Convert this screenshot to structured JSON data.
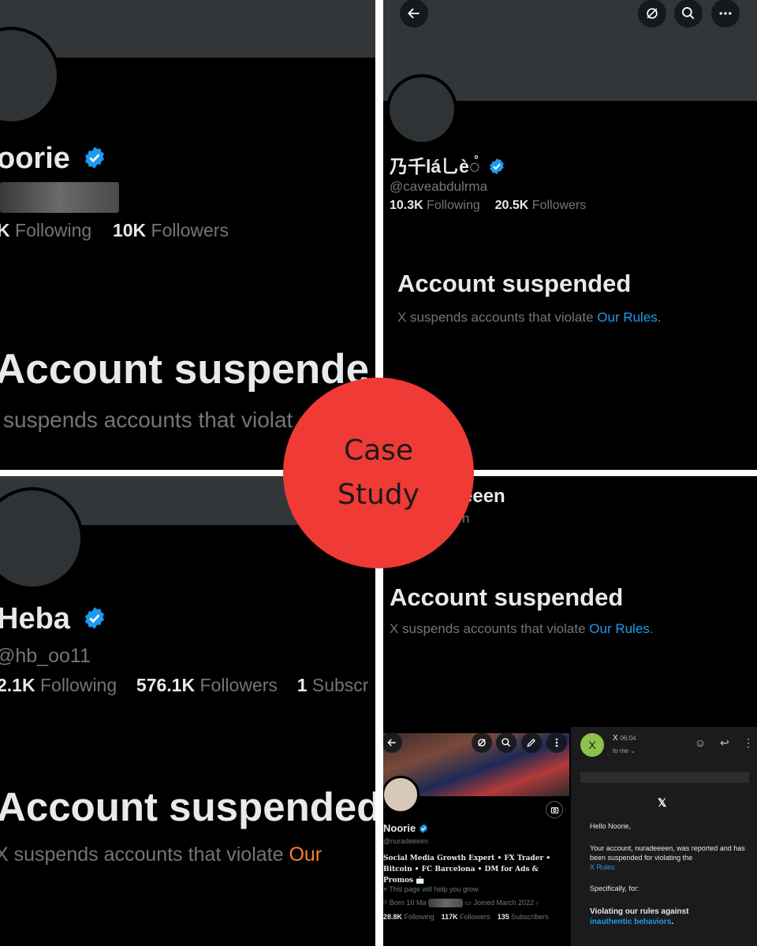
{
  "panel1": {
    "name": "oorie",
    "following_value": "K",
    "following_label": "Following",
    "followers_value": "10K",
    "followers_label": "Followers",
    "suspended_title": "Account suspende",
    "suspended_text": "suspends accounts that violat"
  },
  "panel2": {
    "name": "乃千lá乚è◌̊",
    "handle": "@caveabdulrma",
    "following_value": "10.3K",
    "following_label": "Following",
    "followers_value": "20.5K",
    "followers_label": "Followers",
    "suspended_title": "Account suspended",
    "suspended_text": "X suspends accounts that violate ",
    "rules_link": "Our Rules",
    "rules_period": "."
  },
  "panel3": {
    "name": "Heba",
    "handle": "@hb_oo11",
    "following_value": "2.1K",
    "following_label": "Following",
    "followers_value": "576.1K",
    "followers_label": "Followers",
    "subs_value": "1",
    "subs_label": "Subscr",
    "suspended_title": "Account suspended",
    "suspended_text": "X suspends accounts that violate ",
    "rules_link": "Our"
  },
  "panel4": {
    "name_fragment": "eeen",
    "handle_fragment": "n",
    "suspended_title": "Account suspended",
    "suspended_text": "X suspends accounts that violate ",
    "rules_link": "Our Rules",
    "rules_period": ".",
    "mini_profile": {
      "name": "Noorie",
      "handle": "@nuradeeeen",
      "bio": "Social Media Growth Expert • FX Trader • Bitcoin • FC Barcelona • DM for Ads & Promos 📩",
      "link_text": "This page will help you grow",
      "born": "Born 10 Ma",
      "joined": "Joined March 2022",
      "following_value": "28.8K",
      "following_label": "Following",
      "followers_value": "117K",
      "followers_label": "Followers",
      "subs_value": "135",
      "subs_label": "Subscribers"
    },
    "mail": {
      "avatar_letter": "X",
      "sender": "X",
      "time": "06:04",
      "to": "to me",
      "logo": "𝕏",
      "greeting": "Hello Noorie,",
      "body": "Your account, nuradeeeen, was reported and has been suspended for violating the",
      "rules_link": "X Rules",
      "specifically": "Specifically, for:",
      "violation": "Violating our rules against",
      "violation_link": "inauthentic behaviors"
    }
  },
  "badge": {
    "line1": "Case",
    "line2": "Study"
  },
  "colors": {
    "badge": "#ef3a36",
    "link_blue": "#1d9bf0",
    "orange_link": "#f4812f",
    "verified": "#1d9bf0"
  }
}
